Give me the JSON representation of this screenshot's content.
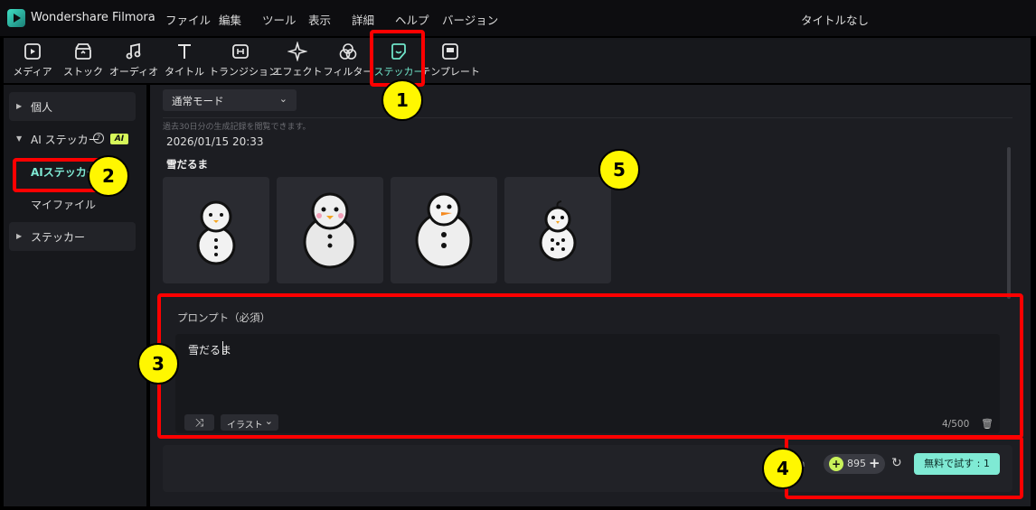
{
  "window": {
    "app_name": "Wondershare Filmora",
    "title": "タイトルなし"
  },
  "menu": [
    "ファイル",
    "編集",
    "ツール",
    "表示",
    "詳細",
    "ヘルプ",
    "バージョン"
  ],
  "toolbar": [
    {
      "label": "メディア",
      "icon": "media-icon"
    },
    {
      "label": "ストック",
      "icon": "stock-icon"
    },
    {
      "label": "オーディオ",
      "icon": "music-note-icon"
    },
    {
      "label": "タイトル",
      "icon": "text-t-icon"
    },
    {
      "label": "トランジション",
      "icon": "transition-icon"
    },
    {
      "label": "エフェクト",
      "icon": "sparkle-icon"
    },
    {
      "label": "フィルター",
      "icon": "filter-icon"
    },
    {
      "label": "ステッカー",
      "icon": "sticker-icon"
    },
    {
      "label": "テンプレート",
      "icon": "template-icon"
    }
  ],
  "sidebar": {
    "personal": "個人",
    "ai_sticker_group": "AI ステッカー",
    "ai_badge": "AI",
    "ai_sticker_item": "AIステッカー",
    "my_file": "マイファイル",
    "sticker": "ステッカー"
  },
  "main": {
    "mode": "通常モード",
    "history_note": "過去30日分の生成記録を閲覧できます。",
    "history_date": "2026/01/15 20:33",
    "history_prompt": "雪だるま"
  },
  "prompt": {
    "label": "プロンプト（必須）",
    "value": "雪だるま",
    "style": "イラスト",
    "char_count": "4/500"
  },
  "footer": {
    "credits": "895",
    "try_free": "無料で試す : 1"
  },
  "annotations": [
    "1",
    "2",
    "3",
    "4",
    "5"
  ],
  "colors": {
    "accent": "#7fead4",
    "highlight_box": "#ff0000",
    "badge": "#fff700"
  }
}
